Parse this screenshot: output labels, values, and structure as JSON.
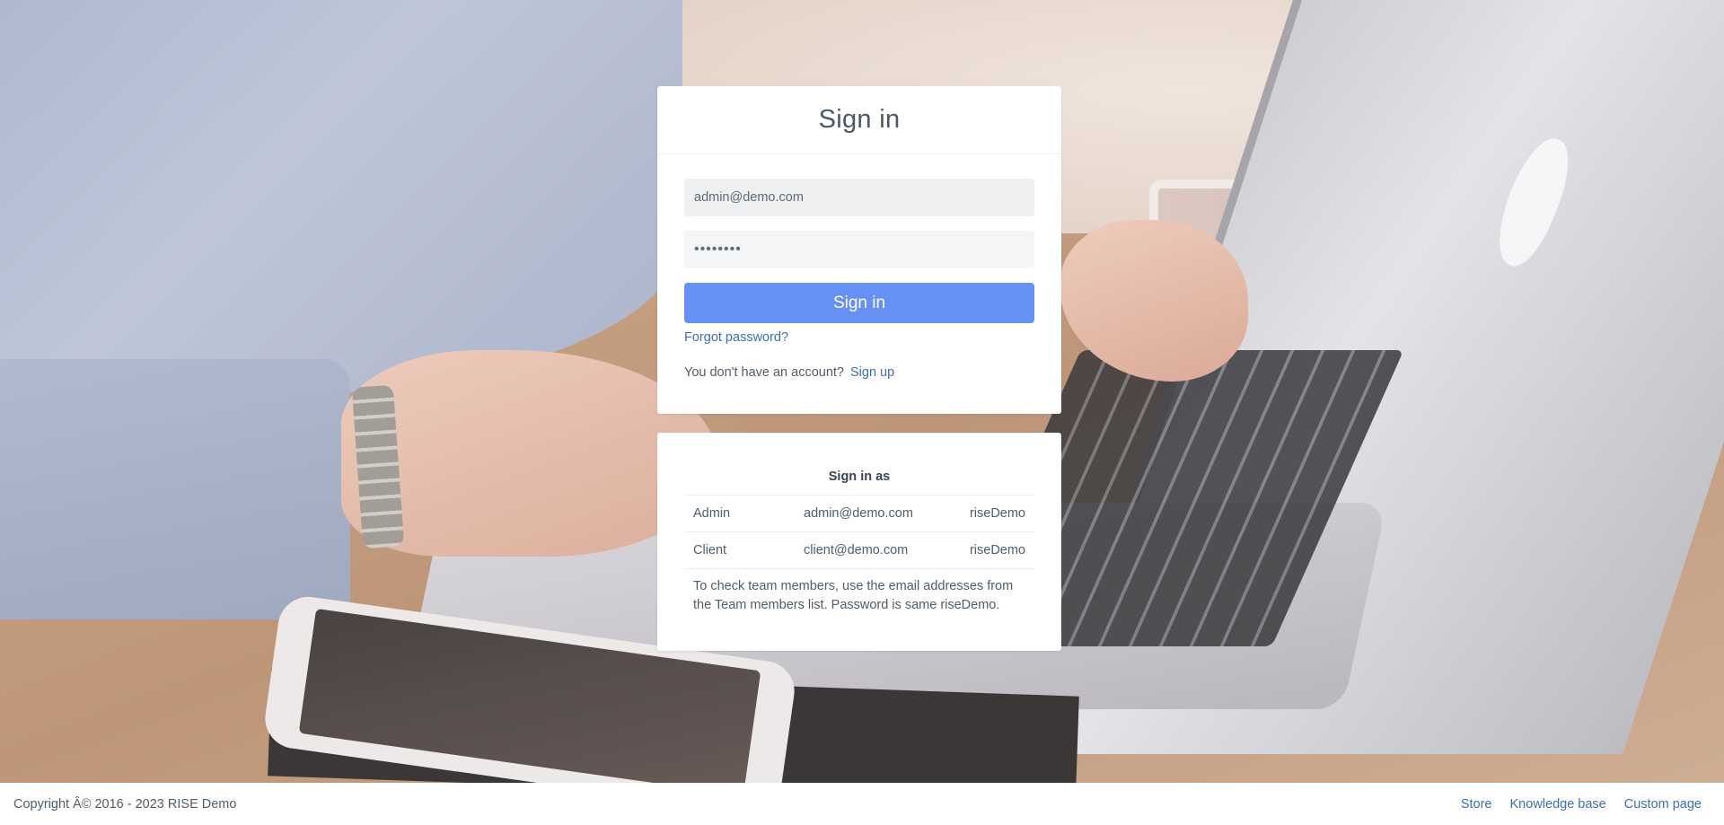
{
  "login": {
    "title": "Sign in",
    "email_value": "admin@demo.com",
    "password_value": "riseDemo",
    "submit_label": "Sign in",
    "forgot_label": "Forgot password?",
    "no_account_text": "You don't have an account?",
    "signup_label": "Sign up"
  },
  "demo_accounts": {
    "title": "Sign in as",
    "rows": [
      {
        "role": "Admin",
        "email": "admin@demo.com",
        "password": "riseDemo"
      },
      {
        "role": "Client",
        "email": "client@demo.com",
        "password": "riseDemo"
      }
    ],
    "note": "To check team members, use the email addresses from the Team members list. Password is same riseDemo."
  },
  "footer": {
    "copyright": "Copyright Â© 2016 - 2023 RISE Demo",
    "links": [
      "Store",
      "Knowledge base",
      "Custom page"
    ]
  },
  "colors": {
    "primary_button": "#6690f4",
    "link": "#3e6eb3"
  }
}
